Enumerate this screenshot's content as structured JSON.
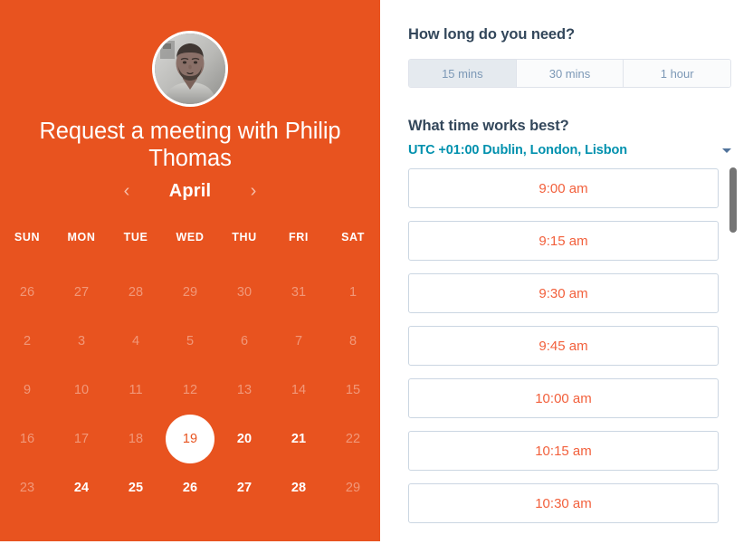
{
  "colors": {
    "brand_orange": "#e8531f",
    "slot_text_orange": "#f2603c",
    "heading_navy": "#33475b",
    "timezone_teal": "#0091ae",
    "border_blue_gray": "#cbd6e2",
    "segment_selected_bg": "#e5eaef",
    "scrollbar_thumb": "#757575"
  },
  "left": {
    "avatar_alt": "avatar",
    "title": "Request a meeting with Philip Thomas",
    "calendar": {
      "prev_arrow": "‹",
      "month": "April",
      "next_arrow": "›",
      "weekdays": [
        "SUN",
        "MON",
        "TUE",
        "WED",
        "THU",
        "FRI",
        "SAT"
      ],
      "weeks": [
        [
          {
            "n": "26",
            "state": "muted"
          },
          {
            "n": "27",
            "state": "muted"
          },
          {
            "n": "28",
            "state": "muted"
          },
          {
            "n": "29",
            "state": "muted"
          },
          {
            "n": "30",
            "state": "muted"
          },
          {
            "n": "31",
            "state": "muted"
          },
          {
            "n": "1",
            "state": "muted"
          }
        ],
        [
          {
            "n": "2",
            "state": "muted"
          },
          {
            "n": "3",
            "state": "muted"
          },
          {
            "n": "4",
            "state": "muted"
          },
          {
            "n": "5",
            "state": "muted"
          },
          {
            "n": "6",
            "state": "muted"
          },
          {
            "n": "7",
            "state": "muted"
          },
          {
            "n": "8",
            "state": "muted"
          }
        ],
        [
          {
            "n": "9",
            "state": "muted"
          },
          {
            "n": "10",
            "state": "muted"
          },
          {
            "n": "11",
            "state": "muted"
          },
          {
            "n": "12",
            "state": "muted"
          },
          {
            "n": "13",
            "state": "muted"
          },
          {
            "n": "14",
            "state": "muted"
          },
          {
            "n": "15",
            "state": "muted"
          }
        ],
        [
          {
            "n": "16",
            "state": "muted"
          },
          {
            "n": "17",
            "state": "muted"
          },
          {
            "n": "18",
            "state": "muted"
          },
          {
            "n": "19",
            "state": "selected"
          },
          {
            "n": "20",
            "state": "available"
          },
          {
            "n": "21",
            "state": "available"
          },
          {
            "n": "22",
            "state": "muted"
          }
        ],
        [
          {
            "n": "23",
            "state": "muted"
          },
          {
            "n": "24",
            "state": "available"
          },
          {
            "n": "25",
            "state": "available"
          },
          {
            "n": "26",
            "state": "available"
          },
          {
            "n": "27",
            "state": "available"
          },
          {
            "n": "28",
            "state": "available"
          },
          {
            "n": "29",
            "state": "muted"
          }
        ]
      ]
    }
  },
  "right": {
    "duration_heading": "How long do you need?",
    "durations": [
      {
        "label": "15 mins",
        "selected": true
      },
      {
        "label": "30 mins",
        "selected": false
      },
      {
        "label": "1 hour",
        "selected": false
      }
    ],
    "time_heading": "What time works best?",
    "timezone": "UTC +01:00 Dublin, London, Lisbon",
    "time_slots": [
      "9:00 am",
      "9:15 am",
      "9:30 am",
      "9:45 am",
      "10:00 am",
      "10:15 am",
      "10:30 am"
    ]
  }
}
